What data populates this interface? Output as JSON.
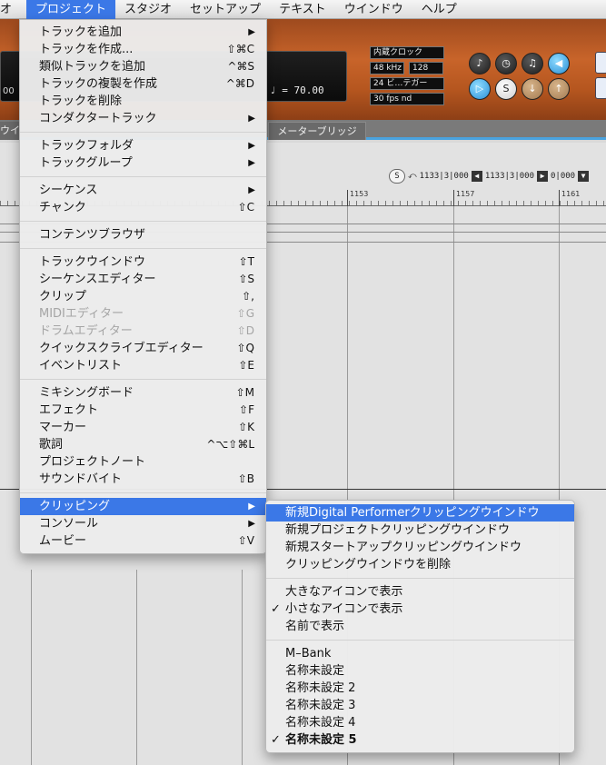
{
  "menubar": {
    "items": [
      "オ",
      "プロジェクト",
      "スタジオ",
      "セットアップ",
      "テキスト",
      "ウインドウ",
      "ヘルプ"
    ],
    "active_index": 1
  },
  "background": {
    "clock_source": "内蔵クロック",
    "sample_rate": "48 kHz",
    "buffer": "128",
    "bit_depth": "24 ビ…テガー",
    "frame_rate": "30 fps nd",
    "tempo": "♩ = 70.00",
    "left_timecode": "00",
    "tab_left_label": "ウイ",
    "tab_bridge_label": "メーターブリッジ",
    "transport": {
      "s_label": "S",
      "loop_start": "1133|3|000",
      "loop_end": "1133|3|000",
      "counter": "0|000"
    },
    "ruler_labels": [
      "1153",
      "1157",
      "1161"
    ]
  },
  "project_menu": {
    "groups": [
      [
        {
          "label": "トラックを追加",
          "shortcut": "",
          "submenu": true,
          "disabled": false
        },
        {
          "label": "トラックを作成...",
          "shortcut": "⇧⌘C",
          "submenu": false,
          "disabled": false
        },
        {
          "label": "類似トラックを追加",
          "shortcut": "^⌘S",
          "submenu": false,
          "disabled": false
        },
        {
          "label": "トラックの複製を作成",
          "shortcut": "^⌘D",
          "submenu": false,
          "disabled": false
        },
        {
          "label": "トラックを削除",
          "shortcut": "",
          "submenu": false,
          "disabled": false
        },
        {
          "label": "コンダクタートラック",
          "shortcut": "",
          "submenu": true,
          "disabled": false
        }
      ],
      [
        {
          "label": "トラックフォルダ",
          "shortcut": "",
          "submenu": true,
          "disabled": false
        },
        {
          "label": "トラックグループ",
          "shortcut": "",
          "submenu": true,
          "disabled": false
        }
      ],
      [
        {
          "label": "シーケンス",
          "shortcut": "",
          "submenu": true,
          "disabled": false
        },
        {
          "label": "チャンク",
          "shortcut": "⇧C",
          "submenu": false,
          "disabled": false
        }
      ],
      [
        {
          "label": "コンテンツブラウザ",
          "shortcut": "",
          "submenu": false,
          "disabled": false
        }
      ],
      [
        {
          "label": "トラックウインドウ",
          "shortcut": "⇧T",
          "submenu": false,
          "disabled": false
        },
        {
          "label": "シーケンスエディター",
          "shortcut": "⇧S",
          "submenu": false,
          "disabled": false
        },
        {
          "label": "クリップ",
          "shortcut": "⇧,",
          "submenu": false,
          "disabled": false
        },
        {
          "label": "MIDIエディター",
          "shortcut": "⇧G",
          "submenu": false,
          "disabled": true
        },
        {
          "label": "ドラムエディター",
          "shortcut": "⇧D",
          "submenu": false,
          "disabled": true
        },
        {
          "label": "クイックスクライブエディター",
          "shortcut": "⇧Q",
          "submenu": false,
          "disabled": false
        },
        {
          "label": "イベントリスト",
          "shortcut": "⇧E",
          "submenu": false,
          "disabled": false
        }
      ],
      [
        {
          "label": "ミキシングボード",
          "shortcut": "⇧M",
          "submenu": false,
          "disabled": false
        },
        {
          "label": "エフェクト",
          "shortcut": "⇧F",
          "submenu": false,
          "disabled": false
        },
        {
          "label": "マーカー",
          "shortcut": "⇧K",
          "submenu": false,
          "disabled": false
        },
        {
          "label": "歌詞",
          "shortcut": "^⌥⇧⌘L",
          "submenu": false,
          "disabled": false
        },
        {
          "label": "プロジェクトノート",
          "shortcut": "",
          "submenu": false,
          "disabled": false
        },
        {
          "label": "サウンドバイト",
          "shortcut": "⇧B",
          "submenu": false,
          "disabled": false
        }
      ],
      [
        {
          "label": "クリッピング",
          "shortcut": "",
          "submenu": true,
          "disabled": false,
          "highlighted": true
        },
        {
          "label": "コンソール",
          "shortcut": "",
          "submenu": true,
          "disabled": false
        },
        {
          "label": "ムービー",
          "shortcut": "⇧V",
          "submenu": false,
          "disabled": false
        }
      ]
    ]
  },
  "clipping_menu": {
    "groups": [
      [
        {
          "label": "新規Digital Performerクリッピングウインドウ",
          "checked": false,
          "highlighted": true
        },
        {
          "label": "新規プロジェクトクリッピングウインドウ",
          "checked": false
        },
        {
          "label": "新規スタートアップクリッピングウインドウ",
          "checked": false
        },
        {
          "label": "クリッピングウインドウを削除",
          "checked": false
        }
      ],
      [
        {
          "label": "大きなアイコンで表示",
          "checked": false
        },
        {
          "label": "小さなアイコンで表示",
          "checked": true
        },
        {
          "label": "名前で表示",
          "checked": false
        }
      ]
    ],
    "bank_header": "M–Bank",
    "bank_items": [
      {
        "label": "名称未設定",
        "checked": false,
        "bold": false
      },
      {
        "label": "名称未設定 2",
        "checked": false,
        "bold": false
      },
      {
        "label": "名称未設定 3",
        "checked": false,
        "bold": false
      },
      {
        "label": "名称未設定 4",
        "checked": false,
        "bold": false
      },
      {
        "label": "名称未設定 5",
        "checked": true,
        "bold": true
      }
    ],
    "check_glyph": "✓",
    "submenu_glyph": "▶"
  },
  "colors": {
    "highlight": "#3b78e7",
    "accent_line": "#4aa3df",
    "wood": "#c8642a"
  }
}
